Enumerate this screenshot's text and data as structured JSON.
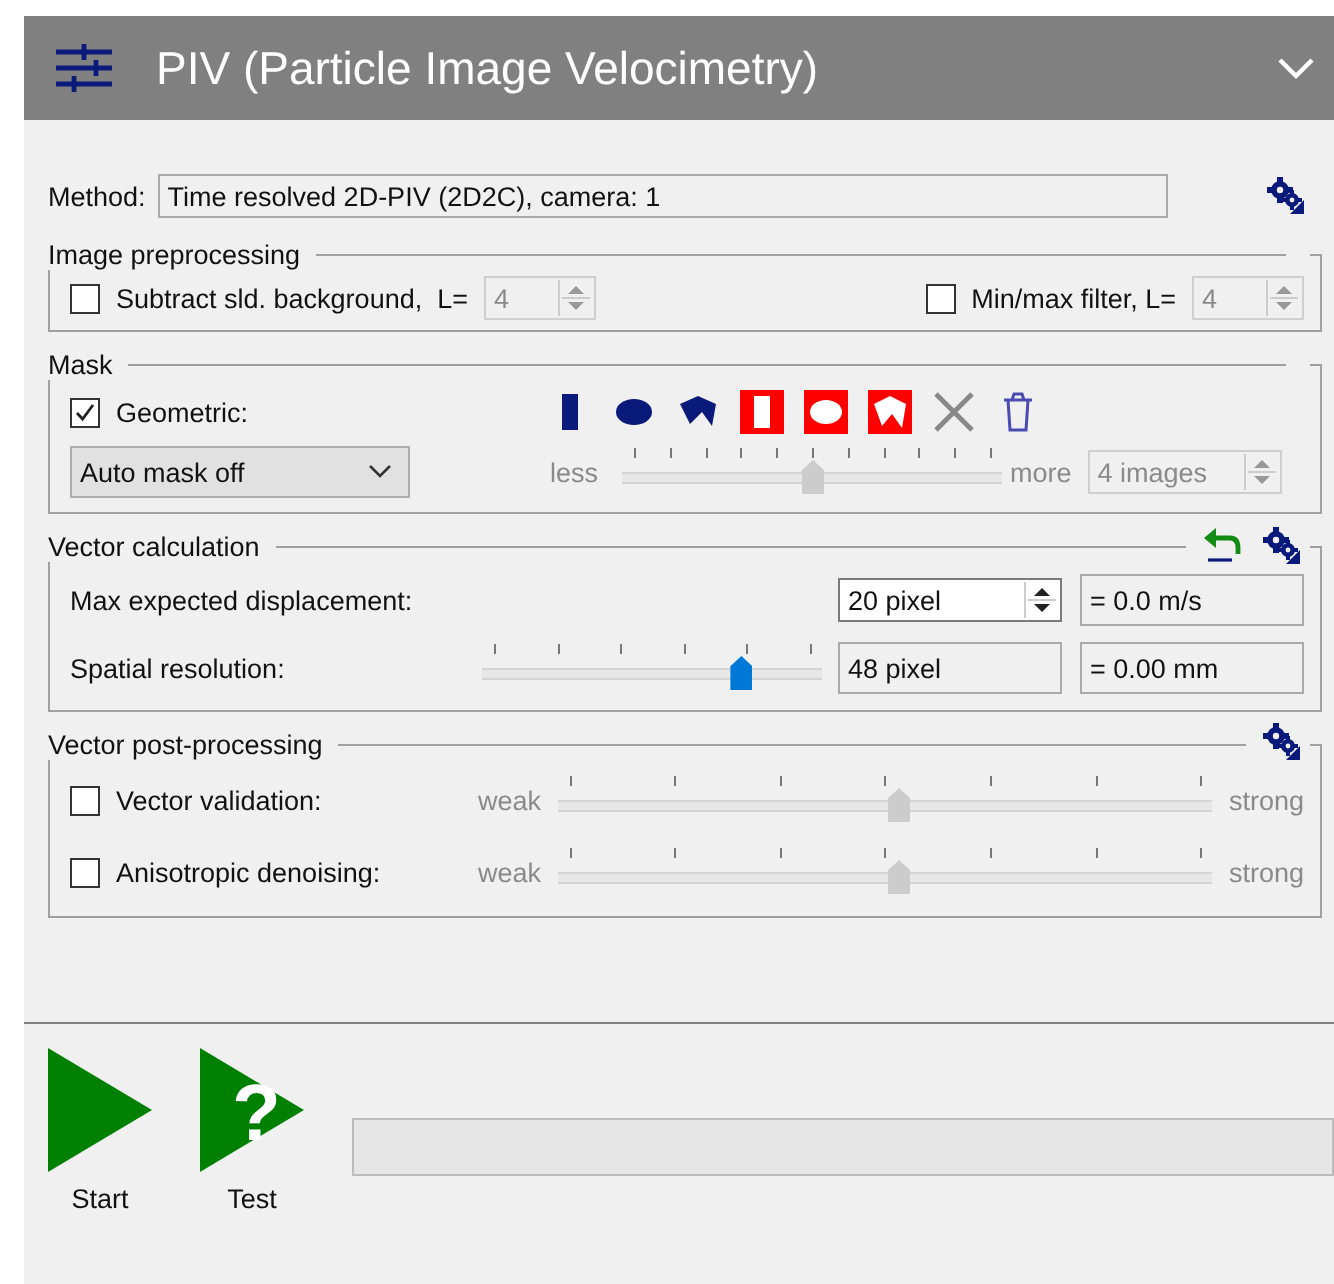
{
  "panel": {
    "title": "PIV (Particle Image Velocimetry)"
  },
  "method": {
    "label": "Method:",
    "value": "Time resolved 2D-PIV (2D2C), camera: 1"
  },
  "image_preprocessing": {
    "title": "Image preprocessing",
    "options": [
      {
        "label": "Subtract sld. background,  L=",
        "checked": false,
        "value": "4",
        "disabled": true
      },
      {
        "label": "Min/max filter, L=",
        "checked": false,
        "value": "4",
        "disabled": true
      }
    ]
  },
  "mask": {
    "title": "Mask",
    "geometric": {
      "label": "Geometric:",
      "checked": true
    },
    "auto_mask": {
      "value": "Auto mask off"
    },
    "sensitivity": {
      "min_label": "less",
      "max_label": "more",
      "level": 0.5,
      "disabled": true
    },
    "images": {
      "value": "4 images",
      "disabled": true
    }
  },
  "vector_calculation": {
    "title": "Vector calculation",
    "rows": [
      {
        "kind": "spin",
        "label": "Max expected displacement:",
        "value": "20 pixel",
        "reading": "= 0.0 m/s"
      },
      {
        "kind": "slider",
        "label": "Spatial resolution:",
        "level": 0.76,
        "value": "48 pixel",
        "reading": "= 0.00 mm"
      }
    ]
  },
  "vector_post_processing": {
    "title": "Vector post-processing",
    "rows": [
      {
        "label": "Vector validation:",
        "checked": false,
        "min_label": "weak",
        "max_label": "strong",
        "level": 0.52,
        "disabled": true
      },
      {
        "label": "Anisotropic denoising:",
        "checked": false,
        "min_label": "weak",
        "max_label": "strong",
        "level": 0.52,
        "disabled": true
      }
    ]
  },
  "actions": [
    {
      "kind": "start",
      "label": "Start"
    },
    {
      "kind": "test",
      "label": "Test",
      "glyph": "?"
    }
  ]
}
